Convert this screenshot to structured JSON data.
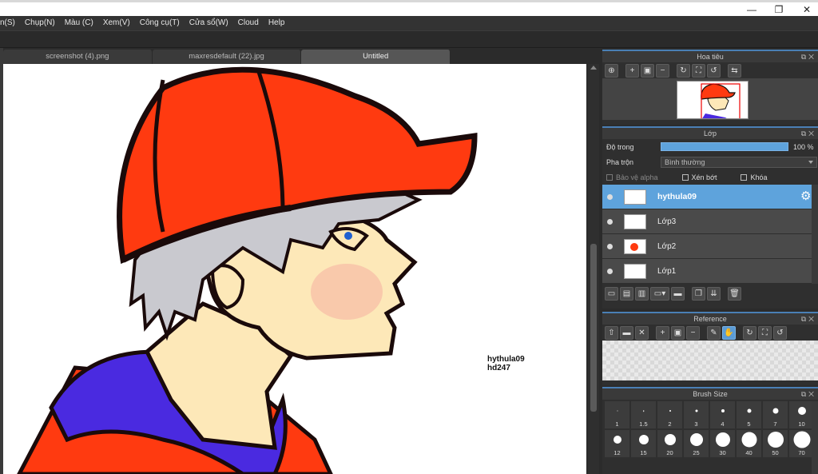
{
  "window": {
    "controls": [
      "—",
      "❐",
      "✕"
    ]
  },
  "menu": [
    "n(S)",
    "Chụp(N)",
    "Màu (C)",
    "Xem(V)",
    "Công cụ(T)",
    "Cửa sổ(W)",
    "Cloud",
    "Help"
  ],
  "tabs": [
    {
      "label": "screenshot (4).png",
      "active": false
    },
    {
      "label": "maxresdefault (22).jpg",
      "active": false
    },
    {
      "label": "Untitled",
      "active": true
    }
  ],
  "canvas": {
    "signature_line1": "hythula09",
    "signature_line2": "hd247"
  },
  "navigator": {
    "title": "Hoa tiêu",
    "icons": [
      "zoom-fit-icon",
      "zoom-in-icon",
      "fit-window-icon",
      "zoom-out-icon",
      "rotate-icon",
      "actual-size-icon",
      "reset-icon",
      "flip-icon"
    ]
  },
  "layers": {
    "title": "Lớp",
    "opacity_label": "Độ trong",
    "opacity_value": "100 %",
    "opacity_fraction": 1.0,
    "blend_label": "Pha trộn",
    "blend_value": "Bình thường",
    "protect_alpha": "Bảo vệ alpha",
    "clipping": "Xén bớt",
    "lock": "Khóa",
    "items": [
      {
        "name": "hythula09",
        "selected": true
      },
      {
        "name": "Lớp3",
        "selected": false
      },
      {
        "name": "Lớp2",
        "selected": false
      },
      {
        "name": "Lớp1",
        "selected": false
      }
    ],
    "footer_icons": [
      "new-layer-icon",
      "new-layer-halftone-icon",
      "new-layer-8bit-icon",
      "add-layer-menu-icon",
      "new-folder-icon",
      "duplicate-layer-icon",
      "merge-layer-icon",
      "delete-layer-icon"
    ]
  },
  "reference": {
    "title": "Reference"
  },
  "brush_size": {
    "title": "Brush Size",
    "sizes": [
      "1",
      "1.5",
      "2",
      "3",
      "4",
      "5",
      "7",
      "10",
      "12",
      "15",
      "20",
      "25",
      "30",
      "40",
      "50",
      "70"
    ]
  }
}
